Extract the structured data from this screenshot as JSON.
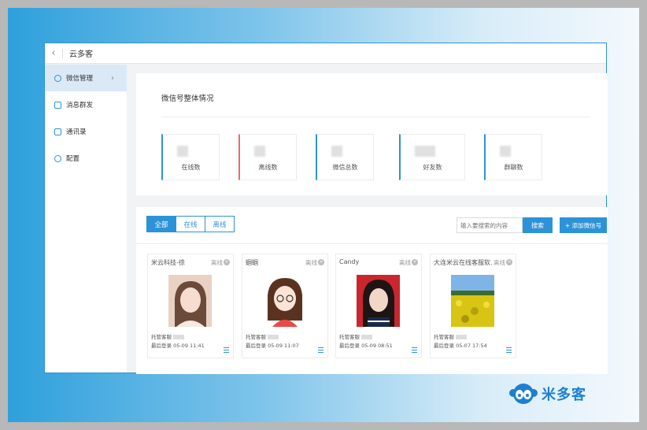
{
  "app": {
    "title": "云多客"
  },
  "sidebar": {
    "items": [
      {
        "label": "微信管理",
        "icon": "wechat-icon"
      },
      {
        "label": "消息群发",
        "icon": "message-icon"
      },
      {
        "label": "通讯录",
        "icon": "contacts-icon"
      },
      {
        "label": "配置",
        "icon": "settings-icon"
      }
    ]
  },
  "overview": {
    "title": "微信号整体情况",
    "stats": [
      {
        "label": "在线数",
        "color": "#2d93d8"
      },
      {
        "label": "离线数",
        "color": "#e86b6b"
      },
      {
        "label": "微信总数",
        "color": "#2d93d8"
      },
      {
        "label": "好友数",
        "color": "#2d93d8"
      },
      {
        "label": "群聊数",
        "color": "#2d93d8"
      }
    ]
  },
  "list": {
    "tabs": [
      "全部",
      "在线",
      "离线"
    ],
    "search_placeholder": "输入要搜索的内容",
    "search_label": "搜索",
    "add_label": "+ 添加微信号",
    "accounts": [
      {
        "name": "米云科技-徐",
        "status": "离线",
        "owner_label": "托管客服",
        "last_login": "最后登录 05-09 11:41"
      },
      {
        "name": "蝈蝈",
        "status": "离线",
        "owner_label": "托管客服",
        "last_login": "最后登录 05-09 11:07"
      },
      {
        "name": "Candy",
        "status": "离线",
        "owner_label": "托管客服",
        "last_login": "最后登录 05-09 08:51"
      },
      {
        "name": "大连米云在线客服软...",
        "status": "离线",
        "owner_label": "托管客服",
        "last_login": "最后登录 05-07 17:54"
      }
    ]
  },
  "brand": {
    "name": "米多客"
  },
  "colors": {
    "accent": "#2d93d8",
    "offline": "#e86b6b"
  }
}
